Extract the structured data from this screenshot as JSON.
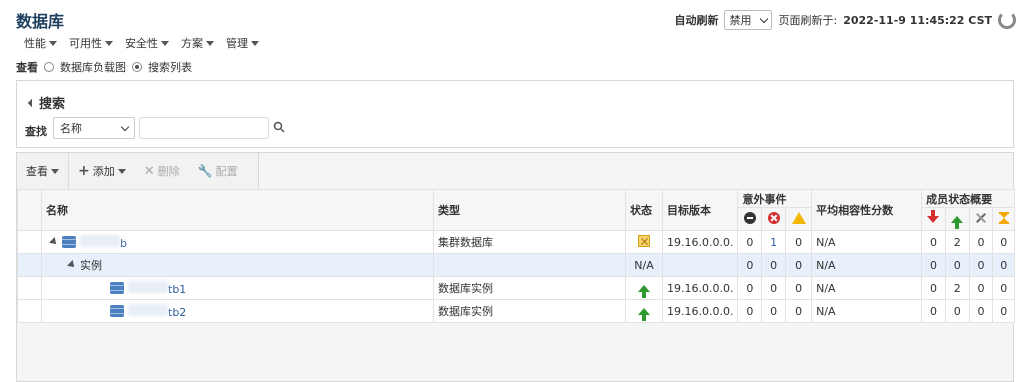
{
  "page": {
    "title": "数据库",
    "menu": [
      "性能",
      "可用性",
      "安全性",
      "方案",
      "管理"
    ],
    "view_label": "查看",
    "view_options": [
      "数据库负载图",
      "搜索列表"
    ],
    "view_selected": "搜索列表"
  },
  "refresh": {
    "label": "自动刷新",
    "select_value": "禁用",
    "last_refresh_label": "页面刷新于:",
    "timestamp": "2022-11-9 11:45:22 CST"
  },
  "search": {
    "title": "搜索",
    "find_label": "查找",
    "find_select": "名称",
    "input_value": ""
  },
  "toolbar": {
    "view": "查看",
    "add": "添加",
    "delete": "删除",
    "config": "配置"
  },
  "table": {
    "headers": {
      "name": "名称",
      "type": "类型",
      "status": "状态",
      "target_version": "目标版本",
      "incidents": "意外事件",
      "avg_compat": "平均相容性分数",
      "member_status": "成员状态概要"
    },
    "rows": [
      {
        "level": 0,
        "name_suffix": "b",
        "type": "集群数据库",
        "status_icon": "status-unknown-icon",
        "version": "19.16.0.0.0.",
        "inc": [
          "0",
          "1",
          "0"
        ],
        "avg": "N/A",
        "members": [
          "0",
          "2",
          "0",
          "0"
        ]
      },
      {
        "level": 1,
        "name": "实例",
        "type": "",
        "status": "N/A",
        "version": "",
        "inc": [
          "0",
          "0",
          "0"
        ],
        "avg": "N/A",
        "members": [
          "0",
          "0",
          "0",
          "0"
        ]
      },
      {
        "level": 2,
        "name_suffix": "tb1",
        "type": "数据库实例",
        "status_icon": "status-up-icon",
        "version": "19.16.0.0.0.",
        "inc": [
          "0",
          "0",
          "0"
        ],
        "avg": "N/A",
        "members": [
          "0",
          "2",
          "0",
          "0"
        ]
      },
      {
        "level": 2,
        "name_suffix": "tb2",
        "type": "数据库实例",
        "status_icon": "status-up-icon",
        "version": "19.16.0.0.0.",
        "inc": [
          "0",
          "0",
          "0"
        ],
        "avg": "N/A",
        "members": [
          "0",
          "0",
          "0",
          "0"
        ]
      }
    ]
  }
}
